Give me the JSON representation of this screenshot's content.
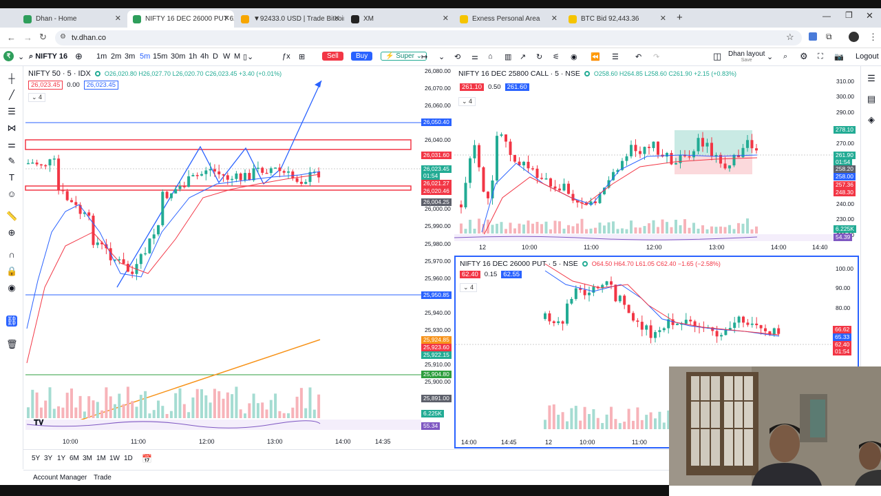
{
  "browser": {
    "tabs": [
      {
        "title": "Dhan - Home",
        "color": "#2e9e5b",
        "active": false
      },
      {
        "title": "NIFTY 16 DEC 26000 PUT 62.40",
        "color": "#2e9e5b",
        "active": true
      },
      {
        "title": "▼92433.0 USD | Trade Bitcoin",
        "color": "#f7a600",
        "active": false
      },
      {
        "title": "XM",
        "color": "#222222",
        "active": false
      },
      {
        "title": "Exness Personal Area",
        "color": "#f5c400",
        "active": false
      },
      {
        "title": "BTC Bid 92,443.36",
        "color": "#f5c400",
        "active": false
      }
    ],
    "url": "tv.dhan.co"
  },
  "toolbar": {
    "symbol": "NIFTY 16",
    "intervals": [
      "1m",
      "2m",
      "3m",
      "5m",
      "15m",
      "30m",
      "1h",
      "4h",
      "D",
      "W",
      "M"
    ],
    "active_interval": "5m",
    "sell_label": "Sell",
    "buy_label": "Buy",
    "super_label": "Super",
    "layout_label": "Dhan layout",
    "layout_sub": "Save",
    "logout_label": "Logout"
  },
  "left_chart": {
    "title": "NIFTY 50 · 5 · IDX",
    "ohlc": "O26,020.80 H26,027.70 L26,020.70 C26,023.45 +3.40 (+0.01%)",
    "bid": "26,023.45",
    "spread": "0.00",
    "ask": "26,023.45",
    "indicator_count": "4",
    "price_axis": [
      "26,080.00",
      "26,070.00",
      "26,060.00",
      "26,040.00",
      "26,030.00",
      "26,010.00",
      "26,000.00",
      "25,990.00",
      "25,980.00",
      "25,970.00",
      "25,960.00",
      "25,940.00",
      "25,930.00",
      "25,910.00",
      "25,900.00"
    ],
    "labels": [
      {
        "text": "26,050.40",
        "color": "#2962ff"
      },
      {
        "text": "26,031.60",
        "color": "#f23645"
      },
      {
        "text": "26,023.45",
        "color": "#22ab94"
      },
      {
        "text": "01:54",
        "color": "#22ab94"
      },
      {
        "text": "26,021.27",
        "color": "#f23645"
      },
      {
        "text": "26,020.46",
        "color": "#f23645"
      },
      {
        "text": "26,004.25",
        "color": "#5d606b"
      },
      {
        "text": "25,950.85",
        "color": "#2962ff"
      },
      {
        "text": "25,924.85",
        "color": "#f7931a"
      },
      {
        "text": "25,923.60",
        "color": "#f23645"
      },
      {
        "text": "25,922.15",
        "color": "#22ab94"
      },
      {
        "text": "25,904.80",
        "color": "#2e9e3e"
      },
      {
        "text": "25,891.00",
        "color": "#5d606b"
      },
      {
        "text": "6.225K",
        "color": "#22ab94"
      },
      {
        "text": "55.34",
        "color": "#7e57c2"
      }
    ],
    "time_axis": [
      "10:00",
      "11:00",
      "12:00",
      "13:00",
      "14:00",
      "14:35"
    ],
    "ranges": [
      "5Y",
      "3Y",
      "1Y",
      "6M",
      "3M",
      "1M",
      "1W",
      "1D"
    ]
  },
  "top_right_chart": {
    "title": "NIFTY 16 DEC 25800 CALL · 5 · NSE",
    "ohlc": "O258.60 H264.85 L258.60 C261.90 +2.15 (+0.83%)",
    "bid": "261.10",
    "spread": "0.50",
    "ask": "261.60",
    "indicator_count": "4",
    "price_axis": [
      "310.00",
      "300.00",
      "290.00",
      "270.00",
      "240.00",
      "230.00",
      "220.00"
    ],
    "labels": [
      {
        "text": "278.10",
        "color": "#22ab94"
      },
      {
        "text": "261.90",
        "color": "#22ab94"
      },
      {
        "text": "01:54",
        "color": "#22ab94"
      },
      {
        "text": "258.20",
        "color": "#5d606b"
      },
      {
        "text": "258.00",
        "color": "#2962ff"
      },
      {
        "text": "257.36",
        "color": "#f23645"
      },
      {
        "text": "248.30",
        "color": "#f23645"
      },
      {
        "text": "6.225K",
        "color": "#22ab94"
      },
      {
        "text": "54.39",
        "color": "#7e57c2"
      }
    ],
    "time_axis": [
      "12",
      "10:00",
      "11:00",
      "12:00",
      "13:00",
      "14:00",
      "14:40"
    ]
  },
  "bottom_right_chart": {
    "title": "NIFTY 16 DEC 26000 PUT · 5 · NSE",
    "ohlc": "O64.50 H64.70 L61.05 C62.40 −1.65 (−2.58%)",
    "bid": "62.40",
    "spread": "0.15",
    "ask": "62.55",
    "indicator_count": "4",
    "price_axis": [
      "100.00",
      "90.00",
      "80.00",
      "70.00"
    ],
    "labels": [
      {
        "text": "66.62",
        "color": "#f23645"
      },
      {
        "text": "65.33",
        "color": "#2962ff"
      },
      {
        "text": "62.40",
        "color": "#f23645"
      },
      {
        "text": "01:54",
        "color": "#f23645"
      }
    ],
    "time_axis": [
      "14:00",
      "14:45",
      "12",
      "10:00",
      "11:00"
    ]
  },
  "bottom": {
    "account_manager": "Account Manager",
    "trade": "Trade"
  }
}
